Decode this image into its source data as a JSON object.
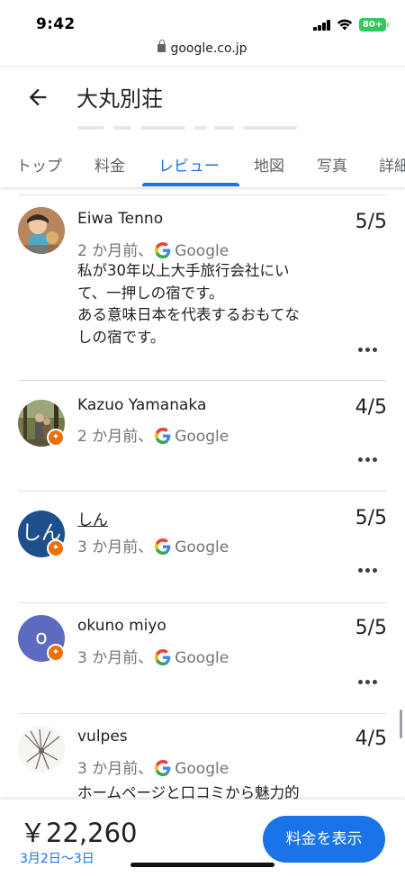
{
  "status_bar": {
    "time": "9:42",
    "battery": "80+",
    "battery_color": "#34c759",
    "icons": [
      "signal-icon",
      "wifi-icon",
      "battery-icon"
    ]
  },
  "browser": {
    "url": "google.co.jp",
    "icons": [
      "lock-icon"
    ]
  },
  "header": {
    "title": "大丸別荘",
    "back_icon": "arrow-back-icon"
  },
  "tabs": [
    {
      "label": "トップ",
      "active": false
    },
    {
      "label": "料金",
      "active": false
    },
    {
      "label": "レビュー",
      "active": true
    },
    {
      "label": "地図",
      "active": false
    },
    {
      "label": "写真",
      "active": false
    },
    {
      "label": "詳細",
      "active": false
    }
  ],
  "reviews": [
    {
      "name": "Eiwa Tenno",
      "time": "2 か月前、",
      "source": "Google",
      "rating": "5/5",
      "text_lines": [
        "私が30年以上大手旅行会社にい",
        "て、一押しの宿です。",
        "ある意味日本を代表するおもてな",
        "しの宿です。"
      ],
      "local_guide": false,
      "more_icon": "more-horizontal-icon"
    },
    {
      "name": "Kazuo Yamanaka",
      "time": "2 か月前、",
      "source": "Google",
      "rating": "4/5",
      "text_lines": [],
      "local_guide": true,
      "more_icon": "more-horizontal-icon"
    },
    {
      "name": "しん",
      "time": "3 か月前、",
      "source": "Google",
      "rating": "5/5",
      "avatar_letter": "しん",
      "avatar_color": "#1f4e8c",
      "text_lines": [],
      "local_guide": true,
      "more_icon": "more-horizontal-icon"
    },
    {
      "name": "okuno miyo",
      "time": "3 か月前、",
      "source": "Google",
      "rating": "5/5",
      "avatar_letter": "o",
      "avatar_color": "#5c6bc0",
      "text_lines": [],
      "local_guide": true,
      "more_icon": "more-horizontal-icon"
    },
    {
      "name": "vulpes",
      "time": "3 か月前、",
      "source": "Google",
      "rating": "4/5",
      "text_lines": [
        "ホームページと口コミから魅力的"
      ],
      "local_guide": false,
      "more_icon": "more-horizontal-icon"
    }
  ],
  "bottom_bar": {
    "price": "￥22,260",
    "dates": "3月2日～3日",
    "cta_label": "料金を表示",
    "accent_color": "#1a73e8"
  }
}
